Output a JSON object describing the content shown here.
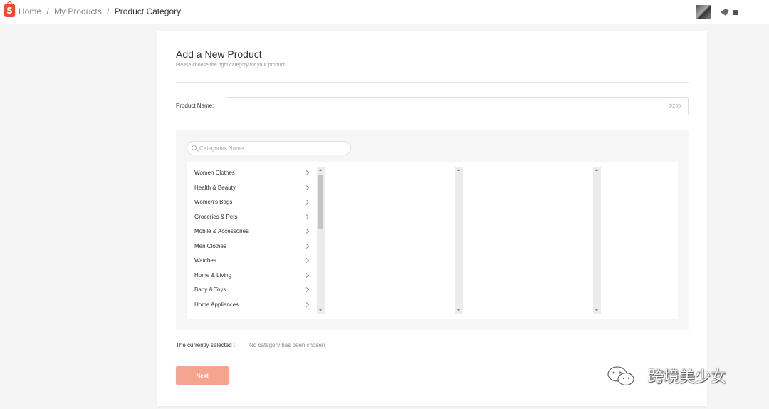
{
  "header": {
    "logo_letter": "S",
    "breadcrumb": [
      {
        "label": "Home"
      },
      {
        "label": "My Products"
      },
      {
        "label": "Product Category"
      }
    ],
    "breadcrumb_separator": "/"
  },
  "form": {
    "title": "Add a New Product",
    "subtitle": "Please choose the right category for your product.",
    "product_name": {
      "label": "Product Name:",
      "value": "",
      "counter": "0/255"
    }
  },
  "categories": {
    "search_placeholder": "Categories Name",
    "level1": [
      {
        "label": "Women Clothes"
      },
      {
        "label": "Health & Beauty"
      },
      {
        "label": "Women's Bags"
      },
      {
        "label": "Groceries & Pets"
      },
      {
        "label": "Mobile & Accessories"
      },
      {
        "label": "Men Clothes"
      },
      {
        "label": "Watches"
      },
      {
        "label": "Home & Living"
      },
      {
        "label": "Baby & Toys"
      },
      {
        "label": "Home Appliances"
      }
    ],
    "level2": [],
    "level3": []
  },
  "selection": {
    "label": "The currently selected :",
    "value": "No category has been chosen"
  },
  "actions": {
    "next_label": "Next"
  },
  "watermark": {
    "text": "跨境美少女"
  },
  "colors": {
    "brand": "#ee4d2d",
    "next_button": "#f5a58f"
  }
}
